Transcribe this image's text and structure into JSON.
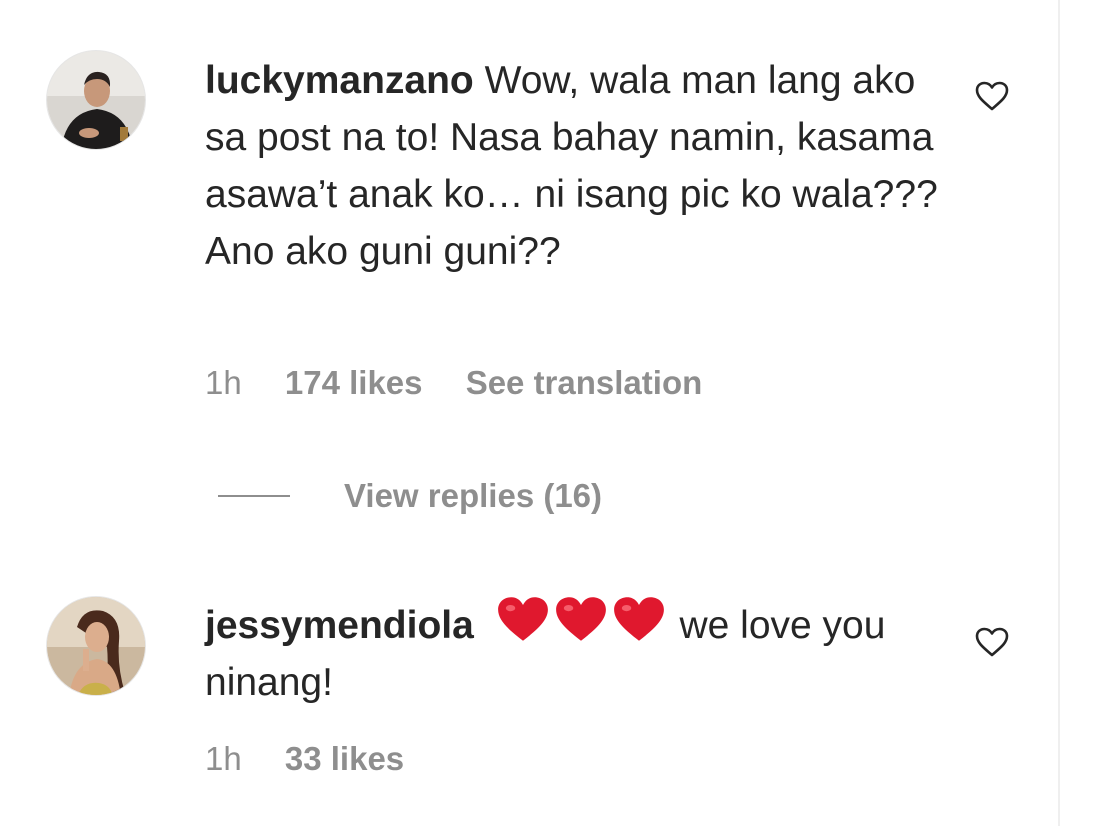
{
  "comments": [
    {
      "username": "luckymanzano",
      "text": " Wow, wala man lang ako sa post na to! Nasa bahay namin, kasama asawa’t anak ko… ni isang pic ko wala??? Ano ako guni guni??",
      "time": "1h",
      "likes": "174 likes",
      "translate": "See translation",
      "avatar_icon": "profile-photo-man"
    },
    {
      "username": "jessymendiola",
      "emoji": "❤️❤️❤️",
      "text": " we love you ninang!",
      "time": "1h",
      "likes": "33 likes",
      "avatar_icon": "profile-photo-woman"
    }
  ],
  "replies": {
    "label": "View replies (16)"
  },
  "colors": {
    "text": "#262626",
    "muted": "#8e8e8e",
    "heart": "#e0182e"
  }
}
